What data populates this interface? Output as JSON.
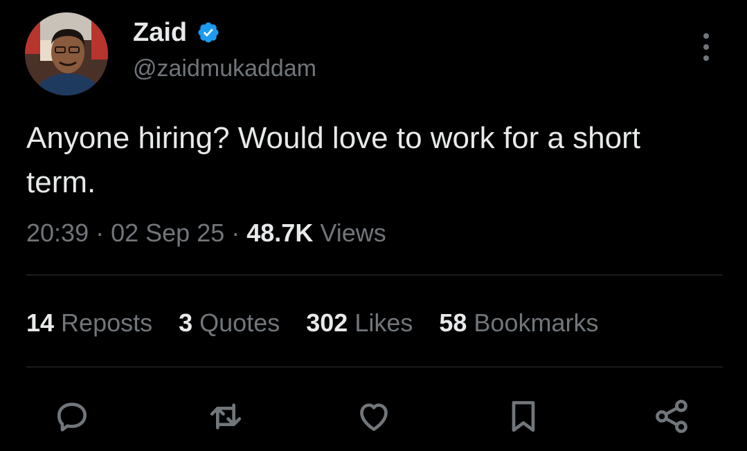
{
  "author": {
    "display_name": "Zaid",
    "handle": "@zaidmukaddam",
    "verified": true
  },
  "tweet": {
    "text": "Anyone hiring? Would love to work for a short term."
  },
  "meta": {
    "time": "20:39",
    "separator": " · ",
    "date": "02 Sep 25",
    "views_count": "48.7K",
    "views_label": " Views"
  },
  "stats": {
    "reposts": {
      "count": "14",
      "label": " Reposts"
    },
    "quotes": {
      "count": "3",
      "label": " Quotes"
    },
    "likes": {
      "count": "302",
      "label": " Likes"
    },
    "bookmarks": {
      "count": "58",
      "label": " Bookmarks"
    }
  },
  "actions": [
    {
      "name": "reply",
      "icon": "reply-icon"
    },
    {
      "name": "repost",
      "icon": "repost-icon"
    },
    {
      "name": "like",
      "icon": "heart-icon"
    },
    {
      "name": "bookmark",
      "icon": "bookmark-icon"
    },
    {
      "name": "share",
      "icon": "share-icon"
    }
  ],
  "colors": {
    "background": "#000000",
    "text_primary": "#e7e9ea",
    "text_secondary": "#71767b",
    "divider": "#2f3336",
    "verified_badge": "#1d9bf0"
  }
}
